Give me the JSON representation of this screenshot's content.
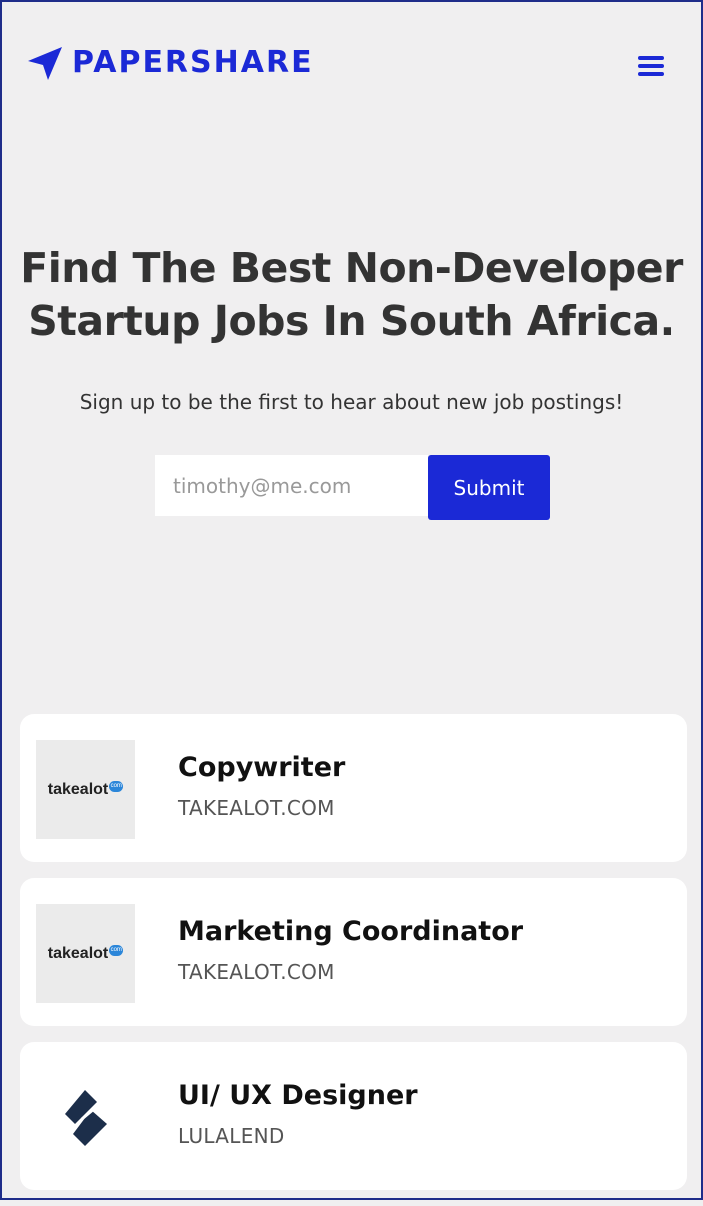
{
  "brand": {
    "name": "PAPERSHARE",
    "color": "#1b29d6"
  },
  "hero": {
    "title_line1": "Find The Best Non-Developer",
    "title_line2": "Startup Jobs In South Africa.",
    "subtitle": "Sign up to be the first to hear about new job postings!"
  },
  "signup": {
    "email_placeholder": "timothy@me.com",
    "submit_label": "Submit"
  },
  "jobs": [
    {
      "title": "Copywriter",
      "company": "TAKEALOT.COM",
      "logo_text": "takealot",
      "logo_badge": "com",
      "logo_icon": "takealot-logo"
    },
    {
      "title": "Marketing Coordinator",
      "company": "TAKEALOT.COM",
      "logo_text": "takealot",
      "logo_badge": "com",
      "logo_icon": "takealot-logo"
    },
    {
      "title": "UI/ UX Designer",
      "company": "LULALEND",
      "logo_icon": "lulalend-logo"
    }
  ]
}
